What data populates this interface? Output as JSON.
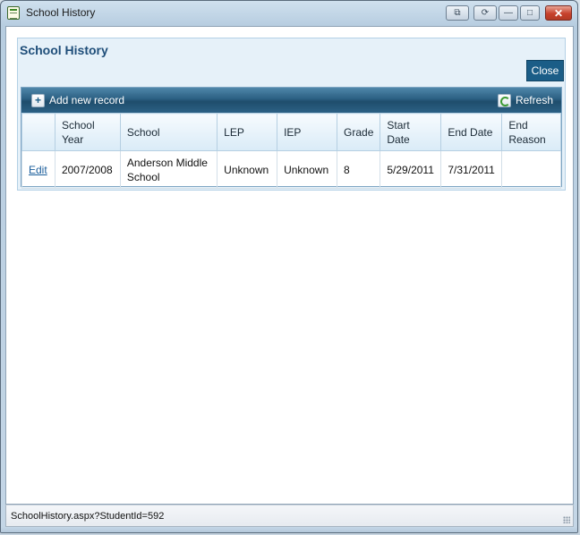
{
  "window": {
    "title": "School History",
    "buttons": {
      "help": "⧉",
      "refresh": "⟳",
      "minimize": "—",
      "maximize": "□",
      "close": "✕"
    }
  },
  "panel": {
    "title": "School History",
    "close_label": "Close"
  },
  "toolbar": {
    "add_label": "Add new record",
    "refresh_label": "Refresh",
    "add_icon": "+"
  },
  "grid": {
    "columns": [
      "",
      "School Year",
      "School",
      "LEP",
      "IEP",
      "Grade",
      "Start Date",
      "End Date",
      "End Reason"
    ],
    "rows": [
      {
        "action": "Edit",
        "school_year": "2007/2008",
        "school": "Anderson Middle School",
        "lep": "Unknown",
        "iep": "Unknown",
        "grade": "8",
        "start_date": "5/29/2011",
        "end_date": "7/31/2011",
        "end_reason": ""
      }
    ]
  },
  "status": {
    "text": "SchoolHistory.aspx?StudentId=592"
  },
  "colors": {
    "accent": "#1b5d87",
    "title": "#1f4e79",
    "toolbar": "#2b5f82"
  }
}
